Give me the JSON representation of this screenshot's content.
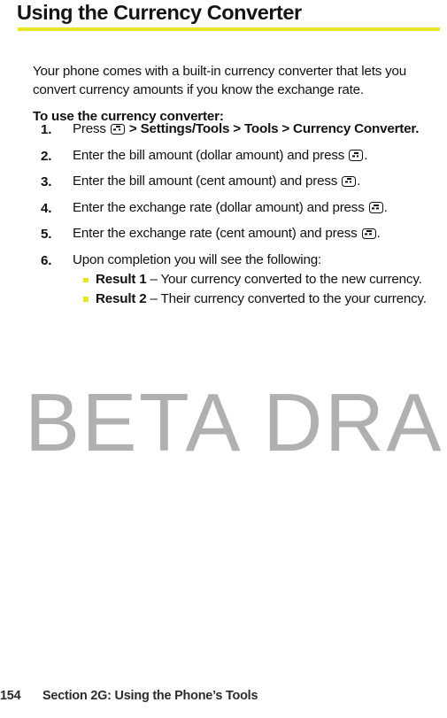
{
  "page": {
    "title": "Using the Currency Converter",
    "rule_color": "#e8e521",
    "bullet_color": "#e8e521"
  },
  "intro": {
    "paragraph": "Your phone comes with a built-in currency converter that lets you convert currency amounts if you know the exchange rate.",
    "lead_in": "To use the currency converter:"
  },
  "steps": [
    {
      "number": "1.",
      "pre": "Press",
      "icon": "menu-key-icon",
      "post_bold": " > Settings/Tools > Tools > Currency Converter.",
      "post": ""
    },
    {
      "number": "2.",
      "pre": "Enter the bill amount (dollar amount) and press",
      "icon": "menu-key-icon",
      "post_bold": "",
      "post": "."
    },
    {
      "number": "3.",
      "pre": "Enter the bill amount (cent amount) and press",
      "icon": "menu-key-icon",
      "post_bold": "",
      "post": "."
    },
    {
      "number": "4.",
      "pre": "Enter the exchange rate (dollar amount) and press",
      "icon": "menu-key-icon",
      "post_bold": "",
      "post": "."
    },
    {
      "number": "5.",
      "pre": "Enter the exchange rate (cent amount) and press",
      "icon": "menu-key-icon",
      "post_bold": "",
      "post": "."
    },
    {
      "number": "6.",
      "pre": "Upon completion you will see the following:",
      "icon": "",
      "post_bold": "",
      "post": ""
    }
  ],
  "sub_items": [
    {
      "label": "Result 1",
      "text": " – Your currency converted to the new currency."
    },
    {
      "label": "Result 2",
      "text": " – Their currency converted to the your currency."
    }
  ],
  "watermark": {
    "text": "BETA DRAFT",
    "color": "#b0b0b0"
  },
  "footer": {
    "page_number": "154",
    "section": "Section 2G: Using the Phone’s Tools"
  }
}
